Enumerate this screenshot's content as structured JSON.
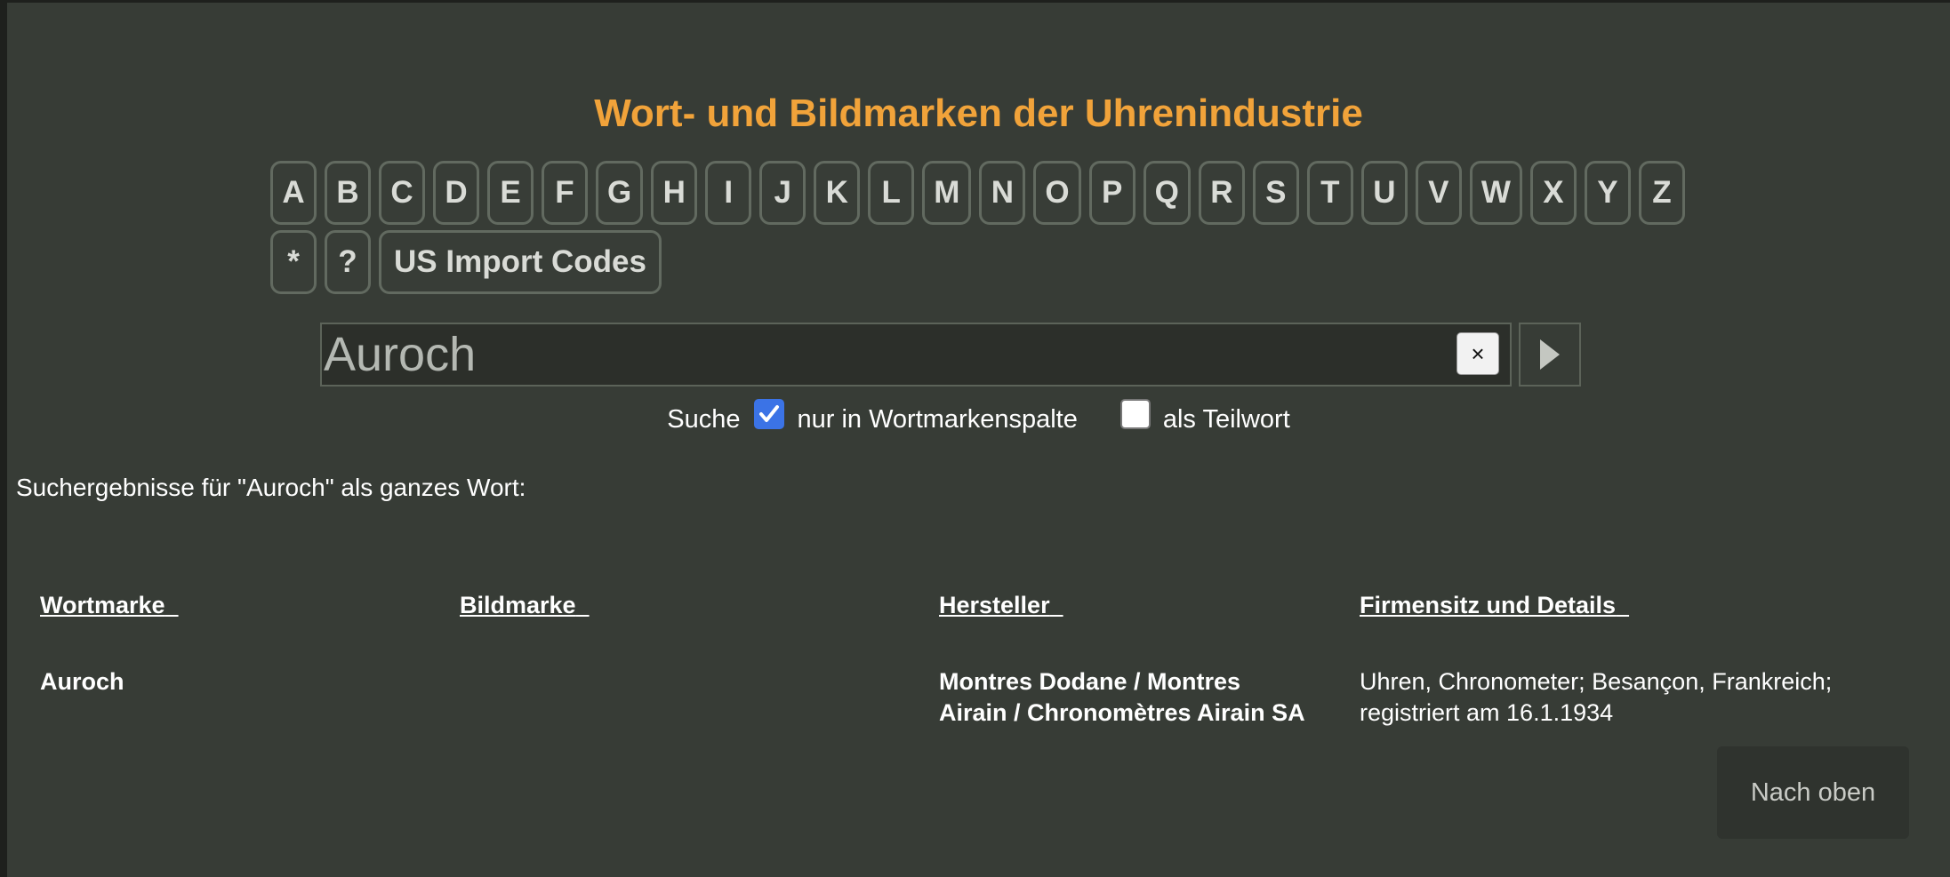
{
  "header": {
    "title": "Wort- und Bildmarken der Uhrenindustrie"
  },
  "alphabet": {
    "letters": [
      "A",
      "B",
      "C",
      "D",
      "E",
      "F",
      "G",
      "H",
      "I",
      "J",
      "K",
      "L",
      "M",
      "N",
      "O",
      "P",
      "Q",
      "R",
      "S",
      "T",
      "U",
      "V",
      "W",
      "X",
      "Y",
      "Z"
    ],
    "extras": [
      "*",
      "?",
      "US Import Codes"
    ]
  },
  "search": {
    "value": "Auroch",
    "clear_label": "×",
    "go_icon": "play-icon"
  },
  "options": {
    "prefix": "Suche",
    "only_wordmark_label": "nur in Wortmarkenspalte",
    "only_wordmark_checked": true,
    "partial_word_label": "als Teilwort",
    "partial_word_checked": false
  },
  "results": {
    "heading": "Suchergebnisse für \"Auroch\" als ganzes Wort:",
    "columns": [
      "Wortmarke",
      "Bildmarke",
      "Hersteller",
      "Firmensitz und Details"
    ],
    "rows": [
      {
        "wortmarke": "Auroch",
        "bildmarke": "",
        "hersteller_line1": "Montres Dodane / Montres",
        "hersteller_line2": "Airain / Chronomètres Airain SA",
        "details_line1": "Uhren, Chronometer; Besançon, Frankreich;",
        "details_line2": "registriert am 16.1.1934"
      }
    ]
  },
  "footer": {
    "back_to_top": "Nach oben"
  },
  "colors": {
    "background": "#373c36",
    "title": "#f1a33a",
    "checkbox_accent": "#3b73e6"
  }
}
